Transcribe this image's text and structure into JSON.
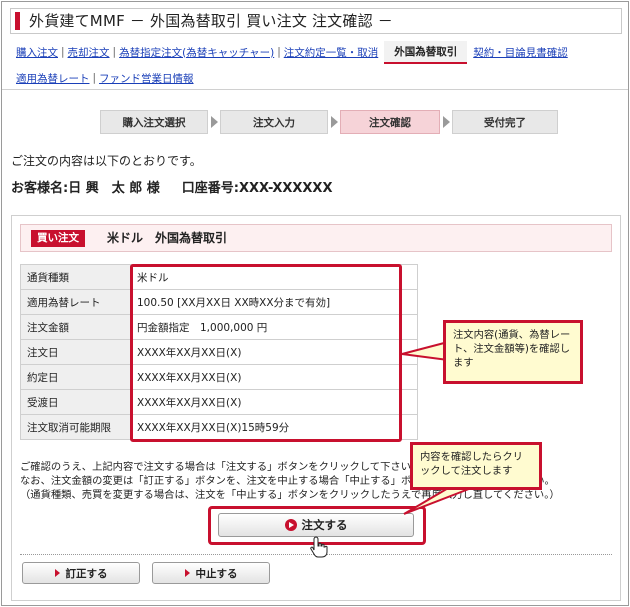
{
  "title": "外貨建てMMF － 外国為替取引 買い注文 注文確認 －",
  "nav": {
    "row1": [
      "購入注文",
      "売却注文",
      "為替指定注文(為替キャッチャー)",
      "注文約定一覧・取消"
    ],
    "active": "外国為替取引",
    "row1_after": [
      "契約・目論見書確認"
    ],
    "row2": [
      "適用為替レート",
      "ファンド営業日情報"
    ]
  },
  "steps": [
    "購入注文選択",
    "注文入力",
    "注文確認",
    "受付完了"
  ],
  "active_step": 2,
  "intro": "ご注文の内容は以下のとおりです。",
  "customer": {
    "name_label": "お客様名:",
    "name": "日 興　太 郎 様",
    "account_label": "口座番号:",
    "account": "XXX-XXXXXX"
  },
  "panel": {
    "badge": "買い注文",
    "title": "米ドル　外国為替取引"
  },
  "details": [
    {
      "label": "通貨種類",
      "value": "米ドル"
    },
    {
      "label": "適用為替レート",
      "value": "100.50 [XX月XX日 XX時XX分まで有効]"
    },
    {
      "label": "注文金額",
      "value": "円金額指定　1,000,000 円"
    },
    {
      "label": "注文日",
      "value": "XXXX年XX月XX日(X)"
    },
    {
      "label": "約定日",
      "value": "XXXX年XX月XX日(X)"
    },
    {
      "label": "受渡日",
      "value": "XXXX年XX月XX日(X)"
    },
    {
      "label": "注文取消可能期限",
      "value": "XXXX年XX月XX日(X)15時59分"
    }
  ],
  "notice": [
    "ご確認のうえ、上記内容で注文する場合は「注文する」ボタンをクリックして下さい。",
    "なお、注文金額の変更は「訂正する」ボタンを、注文を中止する場合「中止する」ボタンをクリックしてください。",
    "（通貨種類、売買を変更する場合は、注文を「中止する」ボタンをクリックしたうえで再度入力し直してください。）"
  ],
  "buttons": {
    "order": "注文する",
    "correct": "訂正する",
    "cancel": "中止する"
  },
  "callouts": {
    "details": "注文内容(通貨、為替レート、注文金額等)を確認します",
    "order": "内容を確認したらクリックして注文します"
  },
  "colors": {
    "accent": "#c8102e",
    "link": "#1a3fb8",
    "callout_bg": "#fffbd0",
    "active_step_bg": "#f6d3d8"
  }
}
